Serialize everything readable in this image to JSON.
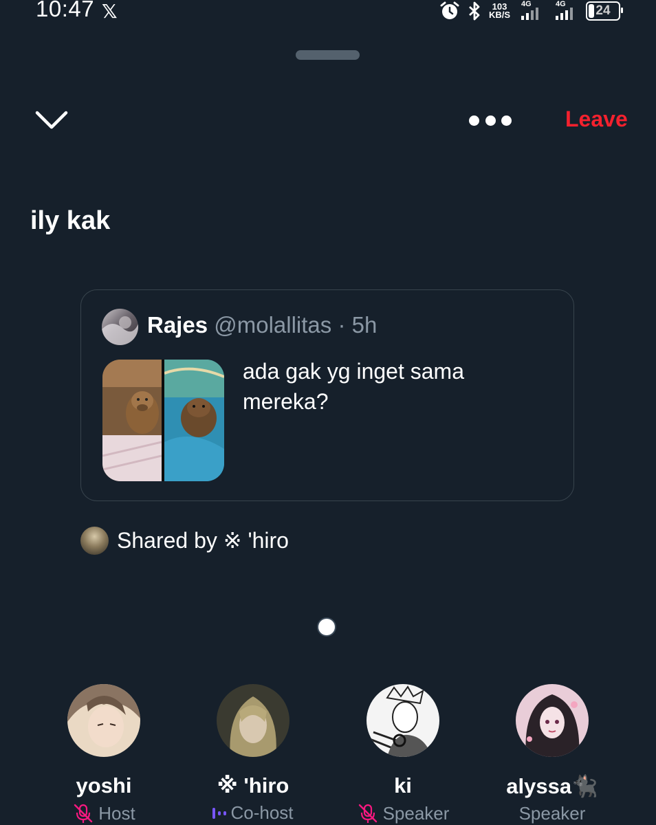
{
  "status_bar": {
    "time": "10:47",
    "app_icon": "x-logo-icon",
    "net_speed_value": "103",
    "net_speed_unit": "KB/S",
    "network_1": "4G",
    "network_2": "4G",
    "battery": "24",
    "icons": [
      "alarm-icon",
      "bluetooth-icon",
      "signal-icon",
      "battery-icon"
    ]
  },
  "header": {
    "leave_label": "Leave",
    "leave_color": "#f4212e"
  },
  "space": {
    "title": "ily kak"
  },
  "tweet": {
    "name": "Rajes",
    "handle": "@molallitas",
    "separator": "·",
    "time": "5h",
    "text": "ada gak yg inget sama mereka?"
  },
  "shared": {
    "prefix": "Shared by",
    "user": "※ 'hiro"
  },
  "participants": [
    {
      "name": "yoshi",
      "role": "Host",
      "role_icon": "mic-off-icon"
    },
    {
      "name": "※ 'hiro",
      "role": "Co-host",
      "role_icon": "speaking-bars-icon"
    },
    {
      "name": "ki",
      "role": "Speaker",
      "role_icon": "mic-off-icon"
    },
    {
      "name": "alyssa🐈‍⬛",
      "role": "Speaker",
      "role_icon": "none"
    }
  ],
  "colors": {
    "background": "#16202b",
    "accent_mic_off": "#f91880",
    "accent_cohost": "#7856ff",
    "muted_text": "#8b98a5"
  }
}
